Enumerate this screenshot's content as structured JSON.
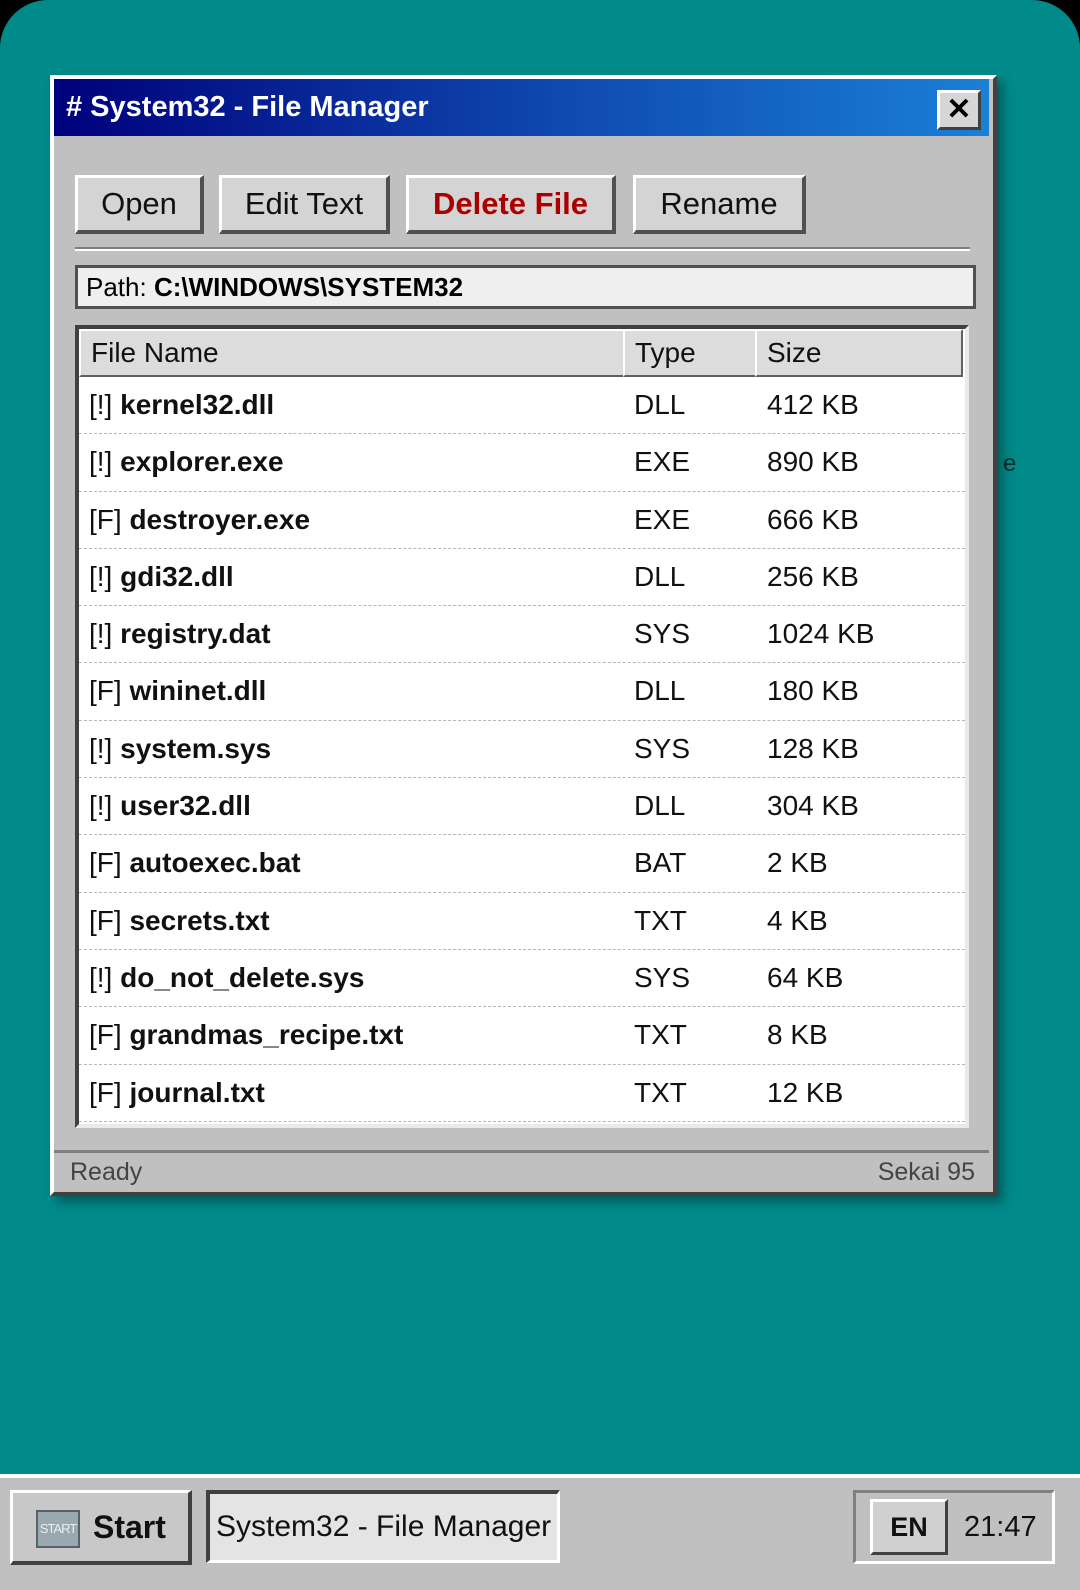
{
  "window": {
    "title": "# System32 - File Manager",
    "close_label": "✕"
  },
  "toolbar": {
    "open_label": "Open",
    "edit_label": "Edit Text",
    "delete_label": "Delete File",
    "rename_label": "Rename"
  },
  "path": {
    "label": "Path:",
    "value": "C:\\WINDOWS\\SYSTEM32"
  },
  "list": {
    "columns": [
      "File Name",
      "Type",
      "Size"
    ],
    "rows": [
      {
        "flag": "[!]",
        "name": "kernel32.dll",
        "type": "DLL",
        "size": "412 KB"
      },
      {
        "flag": "[!]",
        "name": "explorer.exe",
        "type": "EXE",
        "size": "890 KB"
      },
      {
        "flag": "[F]",
        "name": "destroyer.exe",
        "type": "EXE",
        "size": "666 KB"
      },
      {
        "flag": "[!]",
        "name": "gdi32.dll",
        "type": "DLL",
        "size": "256 KB"
      },
      {
        "flag": "[!]",
        "name": "registry.dat",
        "type": "SYS",
        "size": "1024 KB"
      },
      {
        "flag": "[F]",
        "name": "wininet.dll",
        "type": "DLL",
        "size": "180 KB"
      },
      {
        "flag": "[!]",
        "name": "system.sys",
        "type": "SYS",
        "size": "128 KB"
      },
      {
        "flag": "[!]",
        "name": "user32.dll",
        "type": "DLL",
        "size": "304 KB"
      },
      {
        "flag": "[F]",
        "name": "autoexec.bat",
        "type": "BAT",
        "size": "2 KB"
      },
      {
        "flag": "[F]",
        "name": "secrets.txt",
        "type": "TXT",
        "size": "4 KB"
      },
      {
        "flag": "[!]",
        "name": "do_not_delete.sys",
        "type": "SYS",
        "size": "64 KB"
      },
      {
        "flag": "[F]",
        "name": "grandmas_recipe.txt",
        "type": "TXT",
        "size": "8 KB"
      },
      {
        "flag": "[F]",
        "name": "journal.txt",
        "type": "TXT",
        "size": "12 KB"
      }
    ]
  },
  "status": {
    "left": "Ready",
    "right": "Sekai 95"
  },
  "taskbar": {
    "start_icon_text": "START",
    "start_label": "Start",
    "task_label": "System32 - File Manager",
    "lang": "EN",
    "clock": "21:47"
  },
  "desktop": {
    "stray_glyph": "e"
  },
  "colors": {
    "desktop": "#008a8a",
    "title_start": "#00007c",
    "title_end": "#1a80d6",
    "danger": "#aa0000",
    "chrome": "#c0c0c0"
  }
}
